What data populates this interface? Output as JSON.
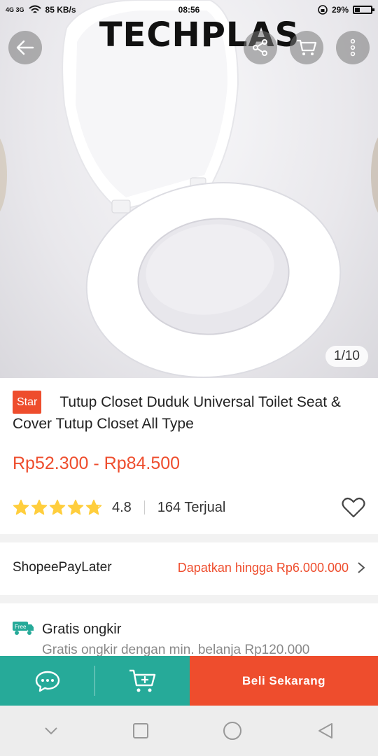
{
  "status_bar": {
    "network": "4G 3G",
    "speed": "85 KB/s",
    "time": "08:56",
    "battery": "29%",
    "battery_level": 0.29
  },
  "hero": {
    "brand_text": "TECHPLAS",
    "counter": "1/10",
    "icons": [
      "back-arrow-icon",
      "share-icon",
      "cart-icon",
      "more-icon"
    ]
  },
  "product": {
    "badge": "Star",
    "title": "Tutup Closet Duduk Universal Toilet Seat & Cover Tutup Closet All Type",
    "price": "Rp52.300 - Rp84.500",
    "rating": "4.8",
    "rating_value": 4.8,
    "sold": "164 Terjual"
  },
  "paylater": {
    "name": "ShopeePayLater",
    "offer": "Dapatkan hingga Rp6.000.000"
  },
  "shipping": {
    "icon_text": "Free",
    "title": "Gratis ongkir",
    "subtitle": "Gratis ongkir dengan min. belanja Rp120.000"
  },
  "actions": {
    "buy_label": "Beli Sekarang"
  },
  "colors": {
    "accent": "#ee4d2d",
    "teal": "#26aa99",
    "star": "#ffce3d"
  }
}
